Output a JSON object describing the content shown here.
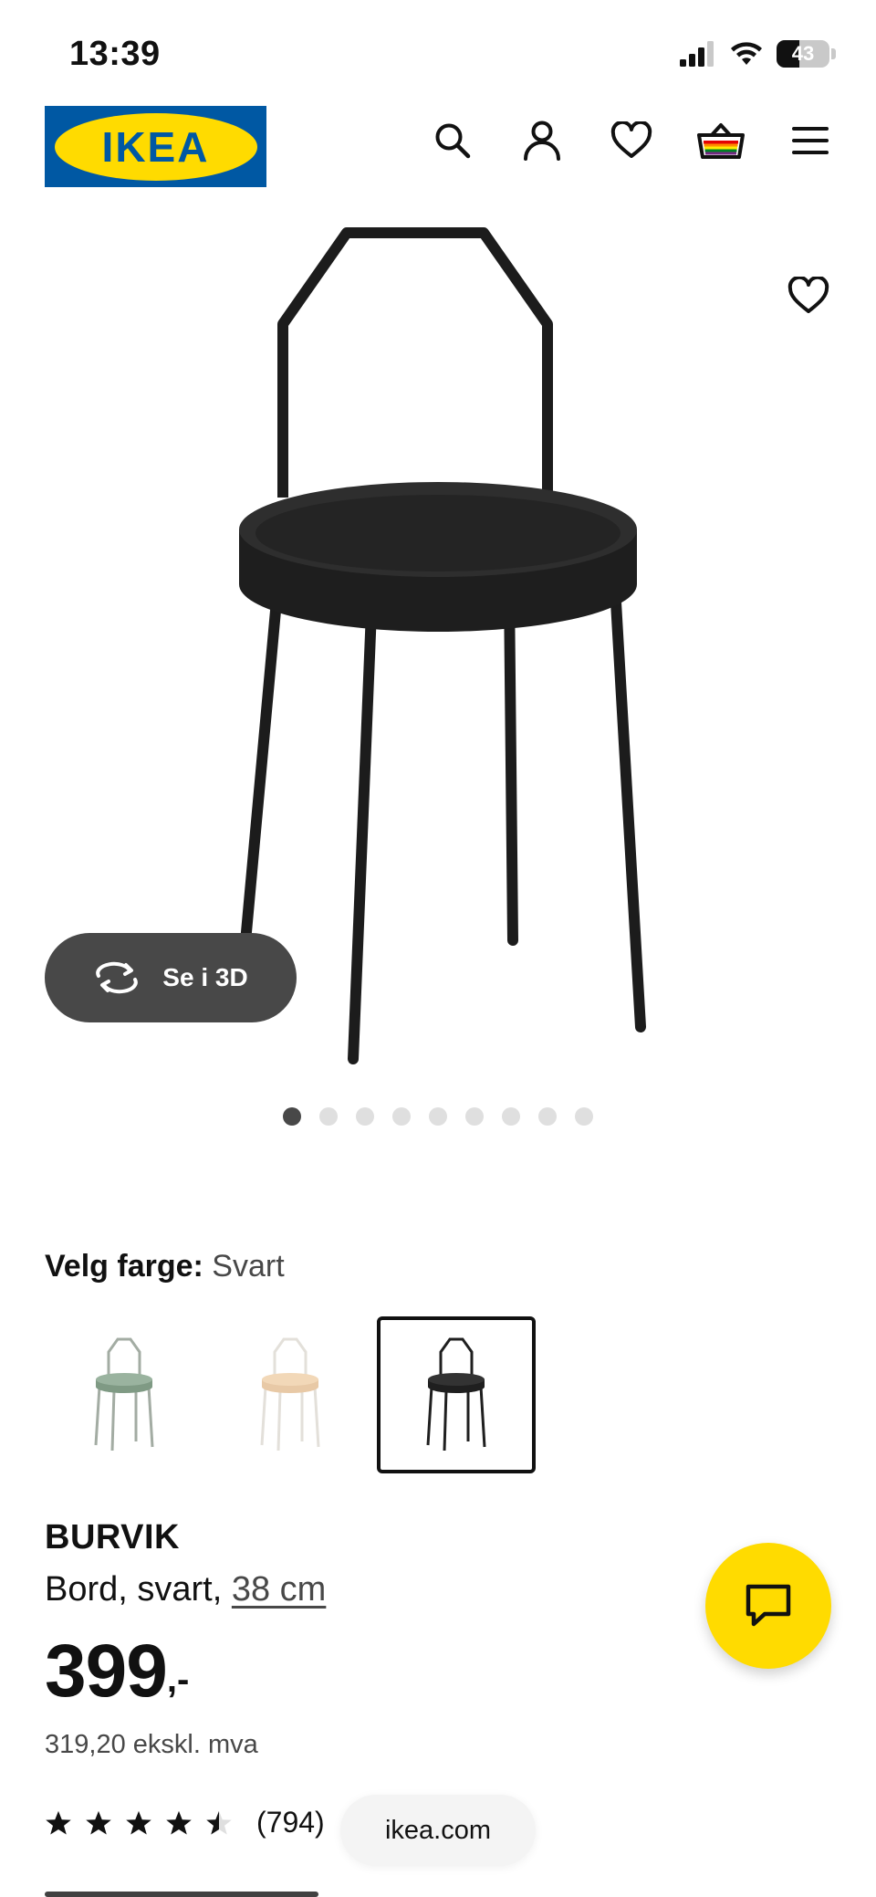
{
  "status_bar": {
    "time": "13:39",
    "battery": "43",
    "battery_level": 0.43
  },
  "header": {
    "logo_text": "IKEA",
    "icons": [
      "search-icon",
      "account-icon",
      "heart-icon",
      "basket-icon",
      "menu-icon"
    ]
  },
  "gallery": {
    "view_3d_label": "Se i 3D",
    "dot_count": 9,
    "active_dot": 0
  },
  "color_select": {
    "label": "Velg farge:",
    "value": "Svart",
    "options": [
      {
        "name": "green",
        "color": "#7f9a84"
      },
      {
        "name": "beige",
        "color": "#e8c9a6"
      },
      {
        "name": "black",
        "color": "#1f1f1f",
        "selected": true
      }
    ]
  },
  "product": {
    "name": "BURVIK",
    "description": "Bord, svart,",
    "size_link": "38 cm",
    "price_int": "399",
    "price_suffix": ",-",
    "price_ex_vat": "319,20 ekskl. mva",
    "rating_value": 4.5,
    "rating_count": "(794)"
  },
  "browser": {
    "url": "ikea.com"
  },
  "colors": {
    "ikea_blue": "#0058a3",
    "ikea_yellow": "#ffdb00",
    "dark_grey": "#484848"
  }
}
